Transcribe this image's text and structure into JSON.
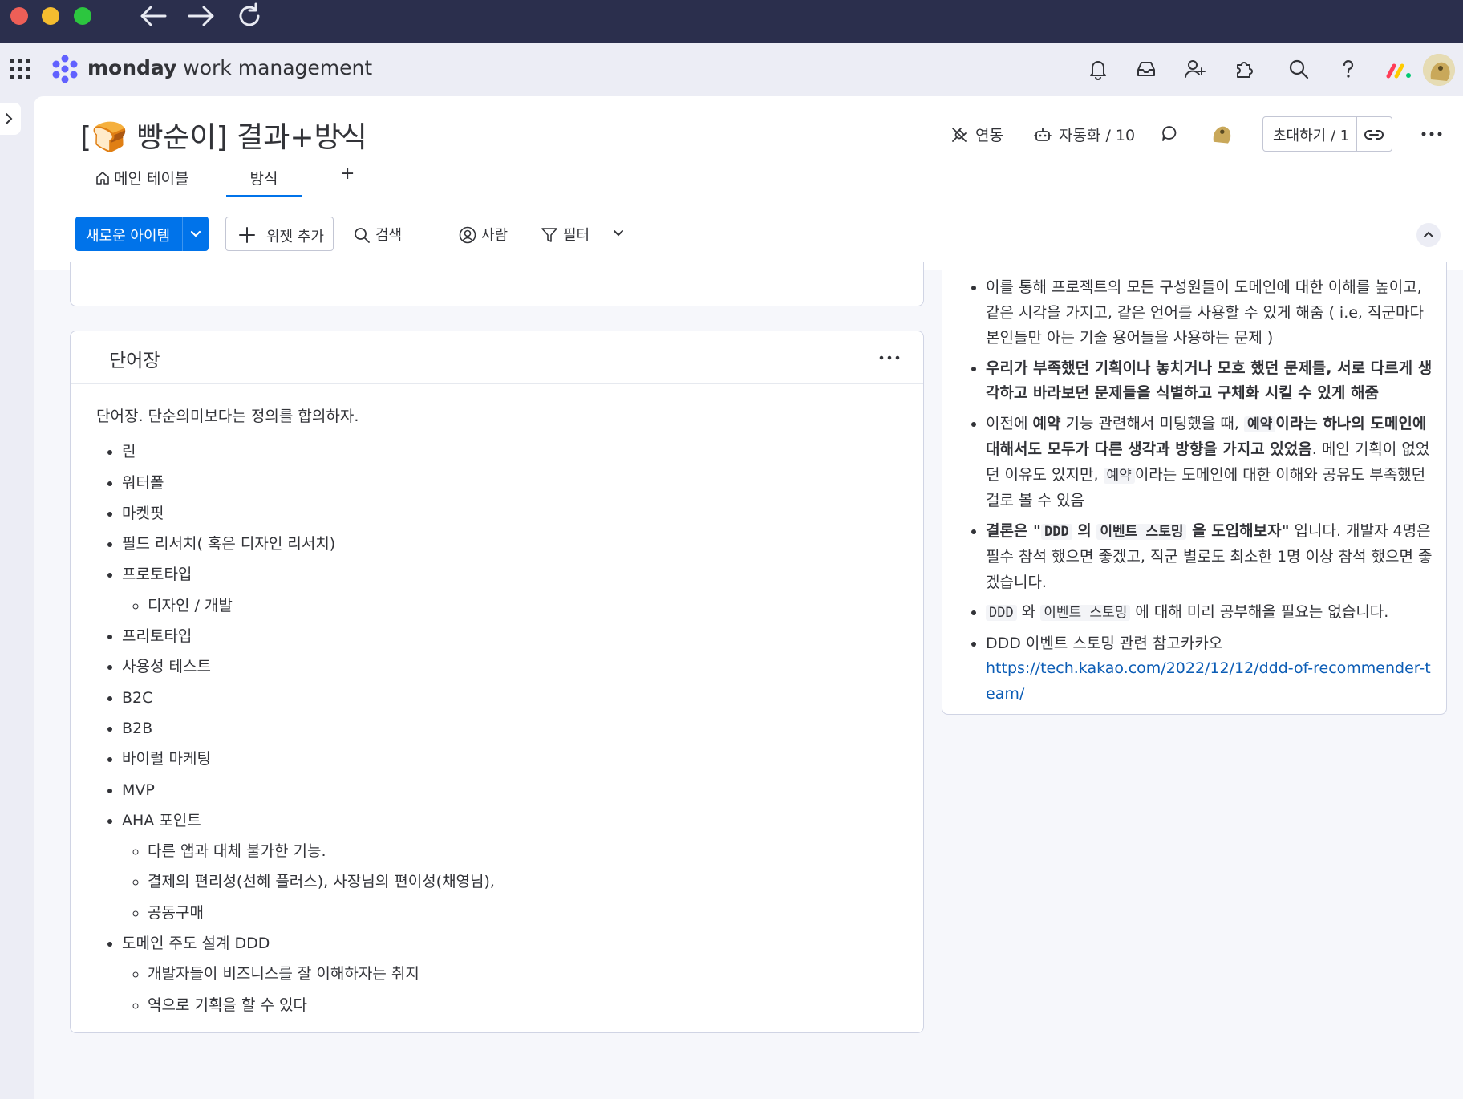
{
  "browser": {
    "traffic_lights": [
      "close",
      "minimize",
      "zoom"
    ],
    "nav_icons": [
      "back-arrow-icon",
      "forward-arrow-icon",
      "reload-icon"
    ]
  },
  "app": {
    "brand_bold": "monday",
    "brand_rest": " work management",
    "header_icons": [
      "bell-icon",
      "inbox-icon",
      "invite-user-icon",
      "puzzle-icon",
      "search-icon",
      "help-icon"
    ]
  },
  "board": {
    "title": "[🍞 빵순이] 결과+방식",
    "tabs": {
      "main": "메인 테이블",
      "method": "방식",
      "add": "+"
    },
    "actions": {
      "integrate": "연동",
      "automate": "자동화 / 10",
      "invite": "초대하기 / 1"
    }
  },
  "toolbar": {
    "new_item": "새로운 아이템",
    "add_widget": "위젯 추가",
    "search": "검색",
    "person": "사람",
    "filter": "필터"
  },
  "vocab": {
    "title": "단어장",
    "intro": "단어장. 단순의미보다는 정의를 합의하자.",
    "items": [
      "린",
      "워터폴",
      "마켓핏",
      "필드 리서치( 혹은 디자인 리서치)",
      "프로토타입",
      "디자인 / 개발",
      "프리토타입",
      "사용성 테스트",
      "B2C",
      "B2B",
      "바이럴 마케팅",
      "MVP",
      "AHA 포인트",
      "다른 앱과 대체 불가한 기능.",
      "결제의 편리성(선혜 플러스), 사장님의 편이성(채영님),",
      "공동구매",
      "도메인 주도 설계 DDD",
      "개발자들이 비즈니스를 잘 이해하자는 취지",
      "역으로 기획을 할 수 있다"
    ]
  },
  "notes": {
    "b1": "이를 통해 프로젝트의 모든 구성원들이 도메인에 대한 이해를 높이고, 같은 시각을 가지고, 같은 언어를 사용할 수 있게 해줌 ( i.e, 직군마다 본인들만 아는 기술 용어들을 사용하는 문제 )",
    "b2": "우리가 부족했던 기획이나 놓치거나 모호 했던 문제들, 서로 다르게 생각하고 바라보던 문제들을 식별하고 구체화 시킬 수 있게 해줌",
    "b3_a": "이전에 ",
    "b3_b": "예약",
    "b3_c": " 기능 관련해서 미팅했을 때, ",
    "b3_d": "예약",
    "b3_e": "이라는 하나의 도메인에 대해서도 모두가 다른 생각과 방향을 가지고 있었음",
    "b3_f": ". 메인 기획이 없었던 이유도 있지만, ",
    "b3_g": "예약",
    "b3_h": "이라는 도메인에 대한 이해와 공유도 부족했던 걸로 볼 수 있음",
    "b4_a": "결론은 \"",
    "b4_b": "DDD",
    "b4_c": " 의 ",
    "b4_d": "이벤트 스토밍",
    "b4_e": " 을 도입해보자\"",
    "b4_f": " 입니다. 개발자 4명은 필수 참석 했으면 좋겠고, 직군 별로도 최소한 1명 이상 참석 했으면 좋겠습니다.",
    "b5_a": "DDD",
    "b5_b": " 와 ",
    "b5_c": "이벤트 스토밍",
    "b5_d": " 에 대해 미리 공부해올 필요는 없습니다.",
    "b6": "DDD 이벤트 스토밍 관련 참고카카오",
    "b6_link": "https://tech.kakao.com/2022/12/12/ddd-of-recommender-team/"
  }
}
